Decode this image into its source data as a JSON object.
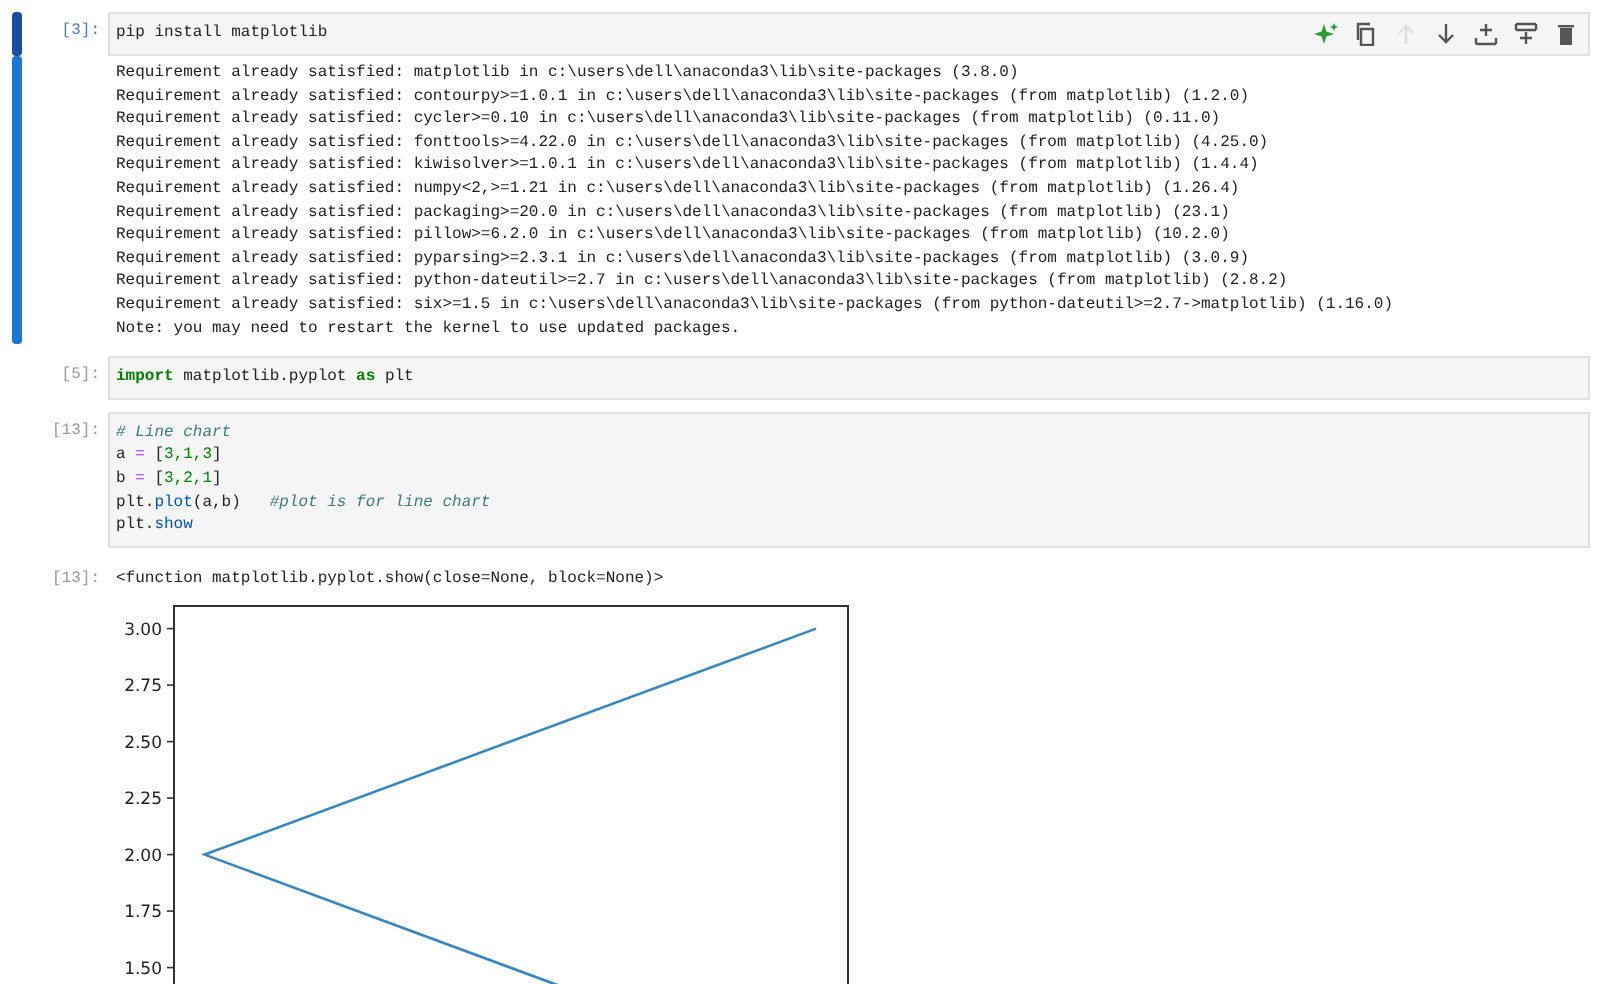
{
  "cells": [
    {
      "prompt": "[3]:",
      "selected": true,
      "toolbar": [
        {
          "kind": "sparkle",
          "disabled": false
        },
        {
          "kind": "copy",
          "disabled": false
        },
        {
          "kind": "up",
          "disabled": true
        },
        {
          "kind": "down",
          "disabled": false
        },
        {
          "kind": "insert-above",
          "disabled": false
        },
        {
          "kind": "insert-below",
          "disabled": false
        },
        {
          "kind": "delete",
          "disabled": false
        }
      ],
      "input": [
        [
          {
            "kind": "plain",
            "text": "pip install matplotlib"
          }
        ]
      ],
      "outputs": [
        {
          "kind": "stream",
          "lines": [
            "Requirement already satisfied: matplotlib in c:\\users\\dell\\anaconda3\\lib\\site-packages (3.8.0)",
            "Requirement already satisfied: contourpy>=1.0.1 in c:\\users\\dell\\anaconda3\\lib\\site-packages (from matplotlib) (1.2.0)",
            "Requirement already satisfied: cycler>=0.10 in c:\\users\\dell\\anaconda3\\lib\\site-packages (from matplotlib) (0.11.0)",
            "Requirement already satisfied: fonttools>=4.22.0 in c:\\users\\dell\\anaconda3\\lib\\site-packages (from matplotlib) (4.25.0)",
            "Requirement already satisfied: kiwisolver>=1.0.1 in c:\\users\\dell\\anaconda3\\lib\\site-packages (from matplotlib) (1.4.4)",
            "Requirement already satisfied: numpy<2,>=1.21 in c:\\users\\dell\\anaconda3\\lib\\site-packages (from matplotlib) (1.26.4)",
            "Requirement already satisfied: packaging>=20.0 in c:\\users\\dell\\anaconda3\\lib\\site-packages (from matplotlib) (23.1)",
            "Requirement already satisfied: pillow>=6.2.0 in c:\\users\\dell\\anaconda3\\lib\\site-packages (from matplotlib) (10.2.0)",
            "Requirement already satisfied: pyparsing>=2.3.1 in c:\\users\\dell\\anaconda3\\lib\\site-packages (from matplotlib) (3.0.9)",
            "Requirement already satisfied: python-dateutil>=2.7 in c:\\users\\dell\\anaconda3\\lib\\site-packages (from matplotlib) (2.8.2)",
            "Requirement already satisfied: six>=1.5 in c:\\users\\dell\\anaconda3\\lib\\site-packages (from python-dateutil>=2.7->matplotlib) (1.16.0)",
            "Note: you may need to restart the kernel to use updated packages."
          ]
        }
      ]
    },
    {
      "prompt": "[5]:",
      "selected": false,
      "input": [
        [
          {
            "kind": "keyword",
            "text": "import"
          },
          {
            "kind": "plain",
            "text": " matplotlib.pyplot "
          },
          {
            "kind": "keyword",
            "text": "as"
          },
          {
            "kind": "plain",
            "text": " plt"
          }
        ]
      ]
    },
    {
      "prompt": "[13]:",
      "selected": false,
      "input": [
        [
          {
            "kind": "comment",
            "text": "# Line chart"
          }
        ],
        [
          {
            "kind": "plain",
            "text": "a "
          },
          {
            "kind": "operator",
            "text": "="
          },
          {
            "kind": "plain",
            "text": " ["
          },
          {
            "kind": "number",
            "text": "3,1,3"
          },
          {
            "kind": "plain",
            "text": "]"
          }
        ],
        [
          {
            "kind": "plain",
            "text": "b "
          },
          {
            "kind": "operator",
            "text": "="
          },
          {
            "kind": "plain",
            "text": " ["
          },
          {
            "kind": "number",
            "text": "3,2,1"
          },
          {
            "kind": "plain",
            "text": "]"
          }
        ],
        [
          {
            "kind": "plain",
            "text": "plt."
          },
          {
            "kind": "call",
            "text": "plot"
          },
          {
            "kind": "plain",
            "text": "(a,b)   "
          },
          {
            "kind": "comment",
            "text": "#plot is for line chart"
          }
        ],
        [
          {
            "kind": "plain",
            "text": "plt."
          },
          {
            "kind": "call",
            "text": "show"
          }
        ]
      ],
      "outputs": [
        {
          "kind": "result",
          "prompt": "[13]:",
          "text": "<function matplotlib.pyplot.show(close=None, block=None)>"
        },
        {
          "kind": "plot",
          "y_tick_labels": [
            "3.00",
            "2.75",
            "2.50",
            "2.25",
            "2.00",
            "1.75",
            "1.50"
          ]
        }
      ]
    }
  ]
}
